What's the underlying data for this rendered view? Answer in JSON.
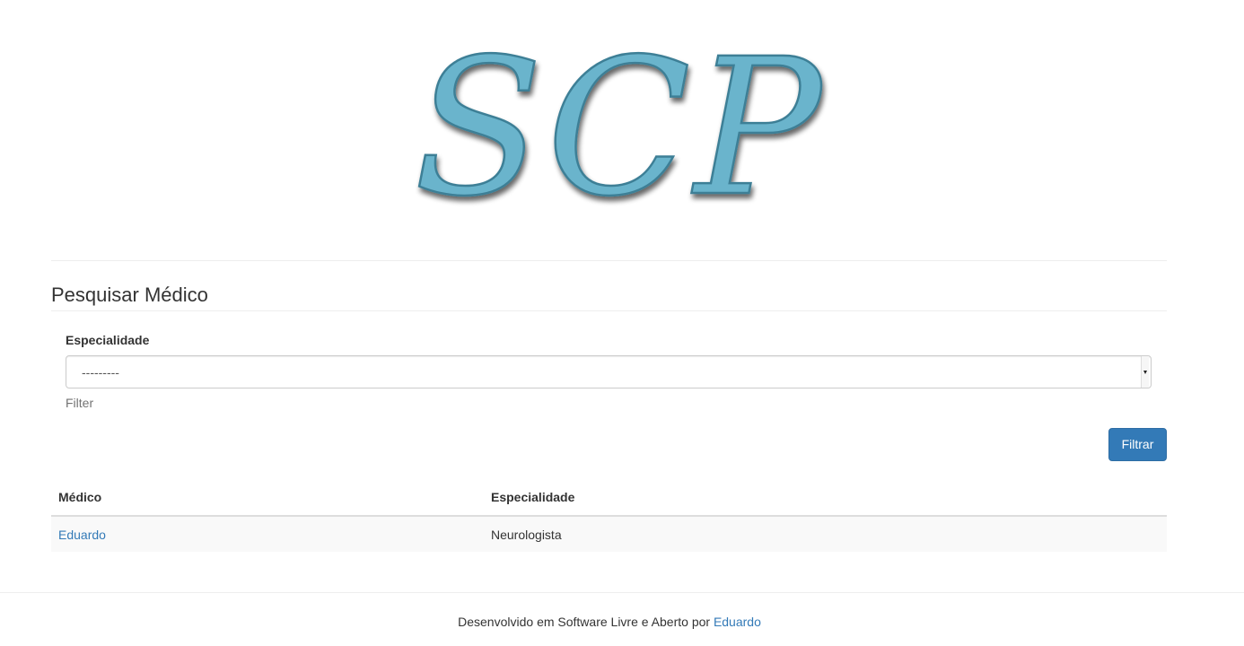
{
  "header": {
    "logo_text": "SCP",
    "logo_color": "#6ab4cc"
  },
  "search": {
    "title": "Pesquisar Médico",
    "specialty_label": "Especialidade",
    "specialty_selected": "---------",
    "help_text": "Filter",
    "filter_button": "Filtrar"
  },
  "results": {
    "columns": [
      "Médico",
      "Especialidade"
    ],
    "rows": [
      {
        "doctor": "Eduardo",
        "specialty": "Neurologista"
      }
    ]
  },
  "footer": {
    "text": "Desenvolvido em Software Livre e Aberto por",
    "author_link": "Eduardo"
  },
  "colors": {
    "primary": "#337ab7",
    "link": "#337ab7",
    "striped_row": "#f9f9f9"
  }
}
